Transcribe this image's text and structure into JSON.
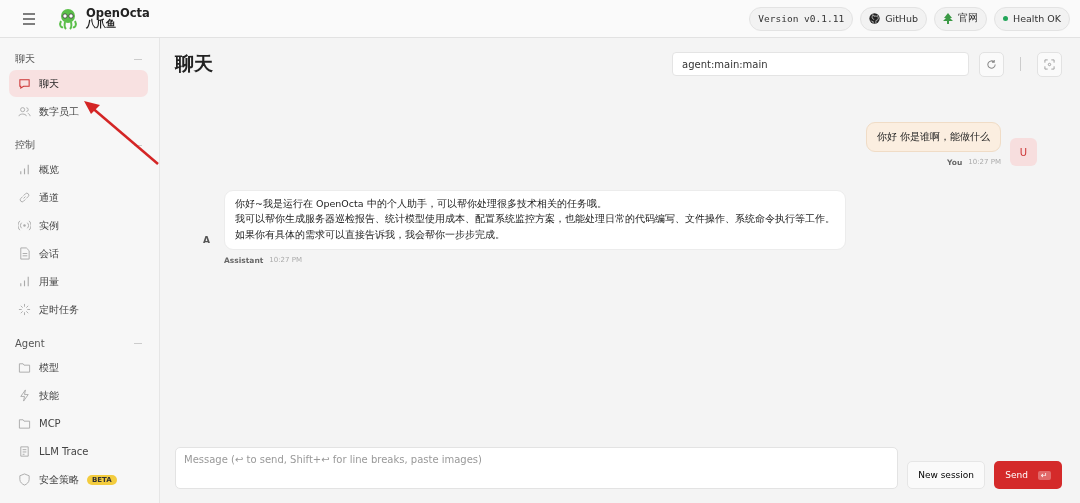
{
  "header": {
    "brand": "OpenOcta",
    "brand_sub": "八爪鱼",
    "version": "Version v0.1.11",
    "github": "GitHub",
    "website": "官网",
    "health": "Health OK"
  },
  "sidebar": {
    "groups": [
      {
        "label": "聊天",
        "items": [
          {
            "label": "聊天",
            "selected": true
          },
          {
            "label": "数字员工",
            "selected": false
          }
        ]
      },
      {
        "label": "控制",
        "items": [
          {
            "label": "概览",
            "selected": false
          },
          {
            "label": "通道",
            "selected": false
          },
          {
            "label": "实例",
            "selected": false
          },
          {
            "label": "会话",
            "selected": false
          },
          {
            "label": "用量",
            "selected": false
          },
          {
            "label": "定时任务",
            "selected": false
          }
        ]
      },
      {
        "label": "Agent",
        "items": [
          {
            "label": "模型",
            "selected": false
          },
          {
            "label": "技能",
            "selected": false
          },
          {
            "label": "MCP",
            "selected": false
          },
          {
            "label": "LLM Trace",
            "selected": false
          },
          {
            "label": "安全策略",
            "selected": false,
            "badge": "BETA"
          }
        ]
      }
    ]
  },
  "chat": {
    "title": "聊天",
    "session": "agent:main:main",
    "messages": [
      {
        "kind": "user",
        "avatar": "U",
        "text": "你好 你是谁啊，能做什么",
        "author": "You",
        "time": "10:27 PM"
      },
      {
        "kind": "assistant",
        "avatar": "A",
        "lines": [
          "你好~我是运行在 OpenOcta 中的个人助手，可以帮你处理很多技术相关的任务哦。",
          "我可以帮你生成服务器巡检报告、统计模型使用成本、配置系统监控方案，也能处理日常的代码编写、文件操作、系统命令执行等工作。",
          "如果你有具体的需求可以直接告诉我，我会帮你一步步完成。"
        ],
        "author": "Assistant",
        "time": "10:27 PM"
      }
    ],
    "composer": {
      "placeholder": "Message (↩ to send, Shift+↩ for line breaks, paste images)",
      "new_session": "New session",
      "send": "Send",
      "send_key": "↵"
    }
  }
}
